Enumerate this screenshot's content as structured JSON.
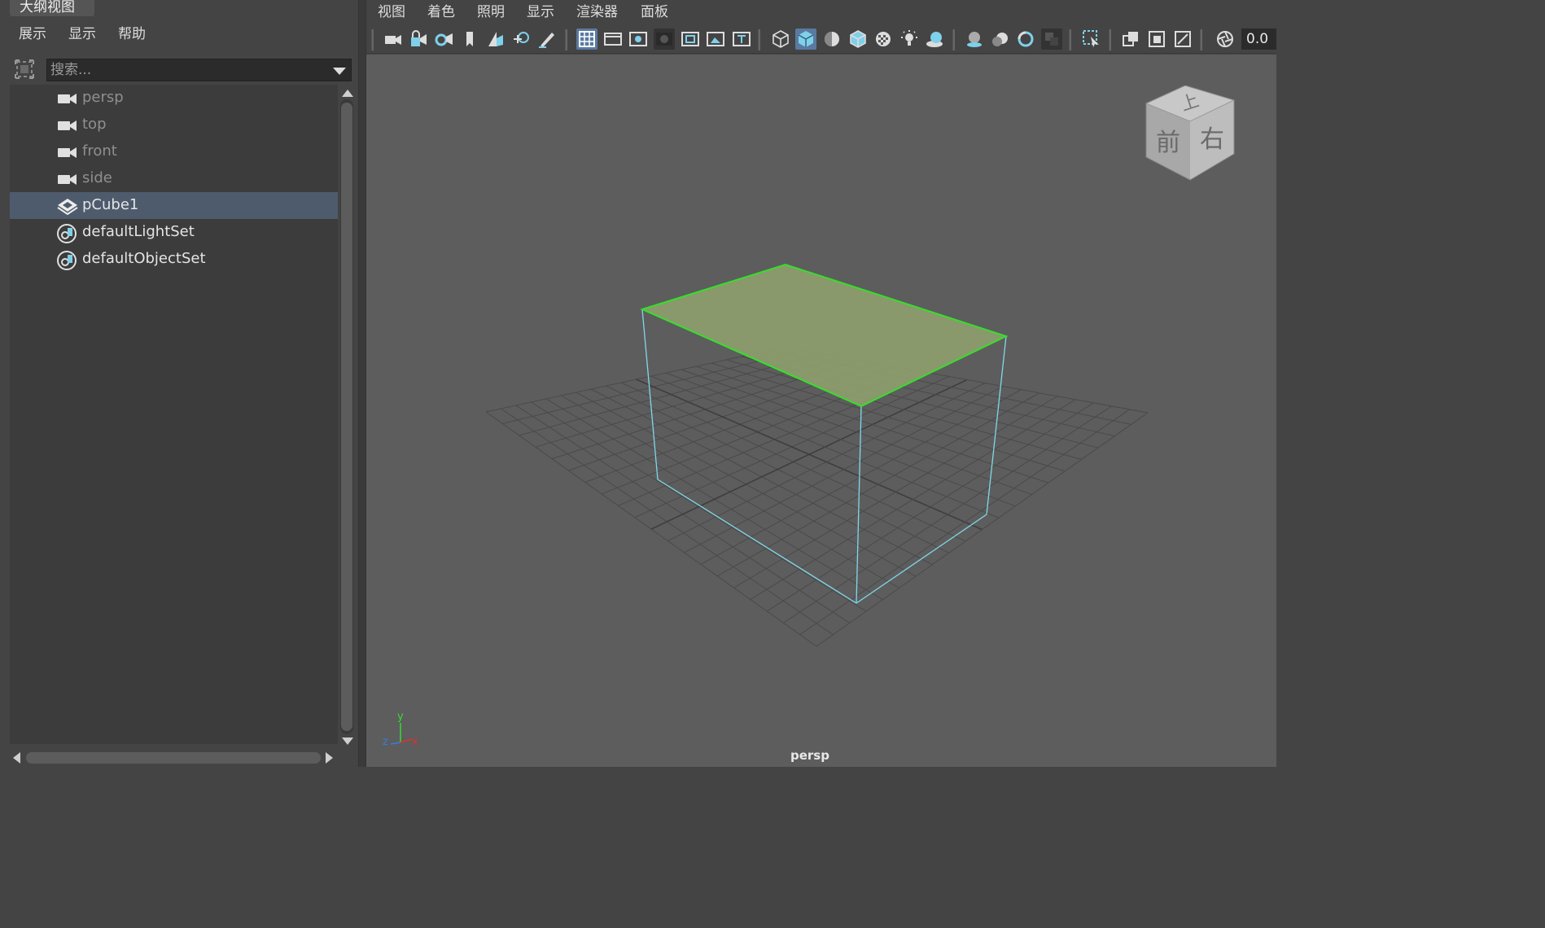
{
  "outliner": {
    "tab_title": "大纲视图",
    "menu": [
      "展示",
      "显示",
      "帮助"
    ],
    "search_placeholder": "搜索...",
    "items": [
      {
        "label": "persp",
        "icon": "camera-icon",
        "selected": false,
        "dim": true
      },
      {
        "label": "top",
        "icon": "camera-icon",
        "selected": false,
        "dim": true
      },
      {
        "label": "front",
        "icon": "camera-icon",
        "selected": false,
        "dim": true
      },
      {
        "label": "side",
        "icon": "camera-icon",
        "selected": false,
        "dim": true
      },
      {
        "label": "pCube1",
        "icon": "mesh-transform-icon",
        "selected": true,
        "dim": false
      },
      {
        "label": "defaultLightSet",
        "icon": "object-set-icon",
        "selected": false,
        "dim": false
      },
      {
        "label": "defaultObjectSet",
        "icon": "object-set-icon",
        "selected": false,
        "dim": false
      }
    ]
  },
  "panel": {
    "menu": [
      "视图",
      "着色",
      "照明",
      "显示",
      "渲染器",
      "面板"
    ],
    "toolbar_field_value": "0.0",
    "camera_label": "persp"
  },
  "view_cube": {
    "top": "上",
    "front": "前",
    "right": "右"
  },
  "axis_gizmo": {
    "x": "x",
    "y": "y",
    "z": "z"
  },
  "colors": {
    "selection_highlight": "#4e5b6d",
    "selected_face": "#8fa06e",
    "selected_edges": "#35e02a",
    "wire_edges": "#7fd8ea",
    "viewport_bg": "#5d5d5d",
    "toolbar_active": "#5a7aa0"
  }
}
